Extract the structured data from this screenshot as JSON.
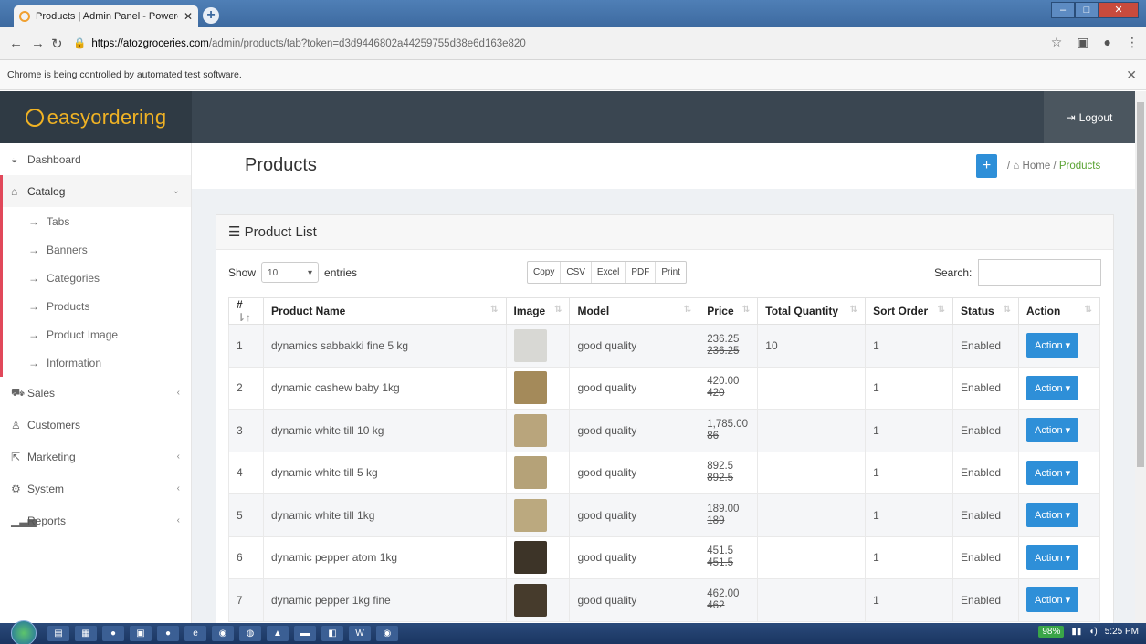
{
  "browser": {
    "tab_title": "Products | Admin Panel - Powere",
    "url_host": "https://atozgroceries.com",
    "url_path": "/admin/products/tab?token=d3d9446802a44259755d38e6d163e820",
    "automation_notice": "Chrome is being controlled by automated test software."
  },
  "header": {
    "logo_text": "easyordering",
    "logout_label": "Logout"
  },
  "sidebar": {
    "items": [
      {
        "label": "Dashboard",
        "icon": "dashboard-icon"
      },
      {
        "label": "Catalog",
        "icon": "catalog-icon"
      },
      {
        "label": "Sales",
        "icon": "cart-icon"
      },
      {
        "label": "Customers",
        "icon": "user-icon"
      },
      {
        "label": "Marketing",
        "icon": "share-icon"
      },
      {
        "label": "System",
        "icon": "gear-icon"
      },
      {
        "label": "Reports",
        "icon": "bar-chart-icon"
      }
    ],
    "catalog_sub": [
      "Tabs",
      "Banners",
      "Categories",
      "Products",
      "Product Image",
      "Information"
    ]
  },
  "page": {
    "title": "Products",
    "breadcrumb_home": "Home",
    "breadcrumb_current": "Products"
  },
  "panel": {
    "title": "Product List",
    "show_label": "Show",
    "entries_value": "10",
    "entries_label": "entries",
    "export_buttons": [
      "Copy",
      "CSV",
      "Excel",
      "PDF",
      "Print"
    ],
    "search_label": "Search:"
  },
  "table": {
    "headers": [
      "#",
      "Product Name",
      "Image",
      "Model",
      "Price",
      "Total Quantity",
      "Sort Order",
      "Status",
      "Action"
    ],
    "rows": [
      {
        "num": "1",
        "name": "dynamics sabbakki fine 5 kg",
        "img_color": "#d8d8d4",
        "model": "good quality",
        "price_new": "236.25",
        "price_old": "236.25",
        "qty": "10",
        "sort": "1",
        "status": "Enabled",
        "action": "Action"
      },
      {
        "num": "2",
        "name": "dynamic cashew baby 1kg",
        "img_color": "#a48a5a",
        "model": "good quality",
        "price_new": "420.00",
        "price_old": "420",
        "qty": "",
        "sort": "1",
        "status": "Enabled",
        "action": "Action"
      },
      {
        "num": "3",
        "name": "dynamic white till 10 kg",
        "img_color": "#b9a57c",
        "model": "good quality",
        "price_new": "1,785.00",
        "price_old": "86",
        "qty": "",
        "sort": "1",
        "status": "Enabled",
        "action": "Action"
      },
      {
        "num": "4",
        "name": "dynamic white till 5 kg",
        "img_color": "#b5a278",
        "model": "good quality",
        "price_new": "892.5",
        "price_old": "892.5",
        "qty": "",
        "sort": "1",
        "status": "Enabled",
        "action": "Action"
      },
      {
        "num": "5",
        "name": "dynamic white till 1kg",
        "img_color": "#bba97f",
        "model": "good quality",
        "price_new": "189.00",
        "price_old": "189",
        "qty": "",
        "sort": "1",
        "status": "Enabled",
        "action": "Action"
      },
      {
        "num": "6",
        "name": "dynamic pepper atom 1kg",
        "img_color": "#3d3428",
        "model": "good quality",
        "price_new": "451.5",
        "price_old": "451.5",
        "qty": "",
        "sort": "1",
        "status": "Enabled",
        "action": "Action"
      },
      {
        "num": "7",
        "name": "dynamic pepper 1kg fine",
        "img_color": "#463b2c",
        "model": "good quality",
        "price_new": "462.00",
        "price_old": "462",
        "qty": "",
        "sort": "1",
        "status": "Enabled",
        "action": "Action"
      }
    ]
  },
  "taskbar": {
    "battery": "98%",
    "time": "5:25 PM"
  }
}
